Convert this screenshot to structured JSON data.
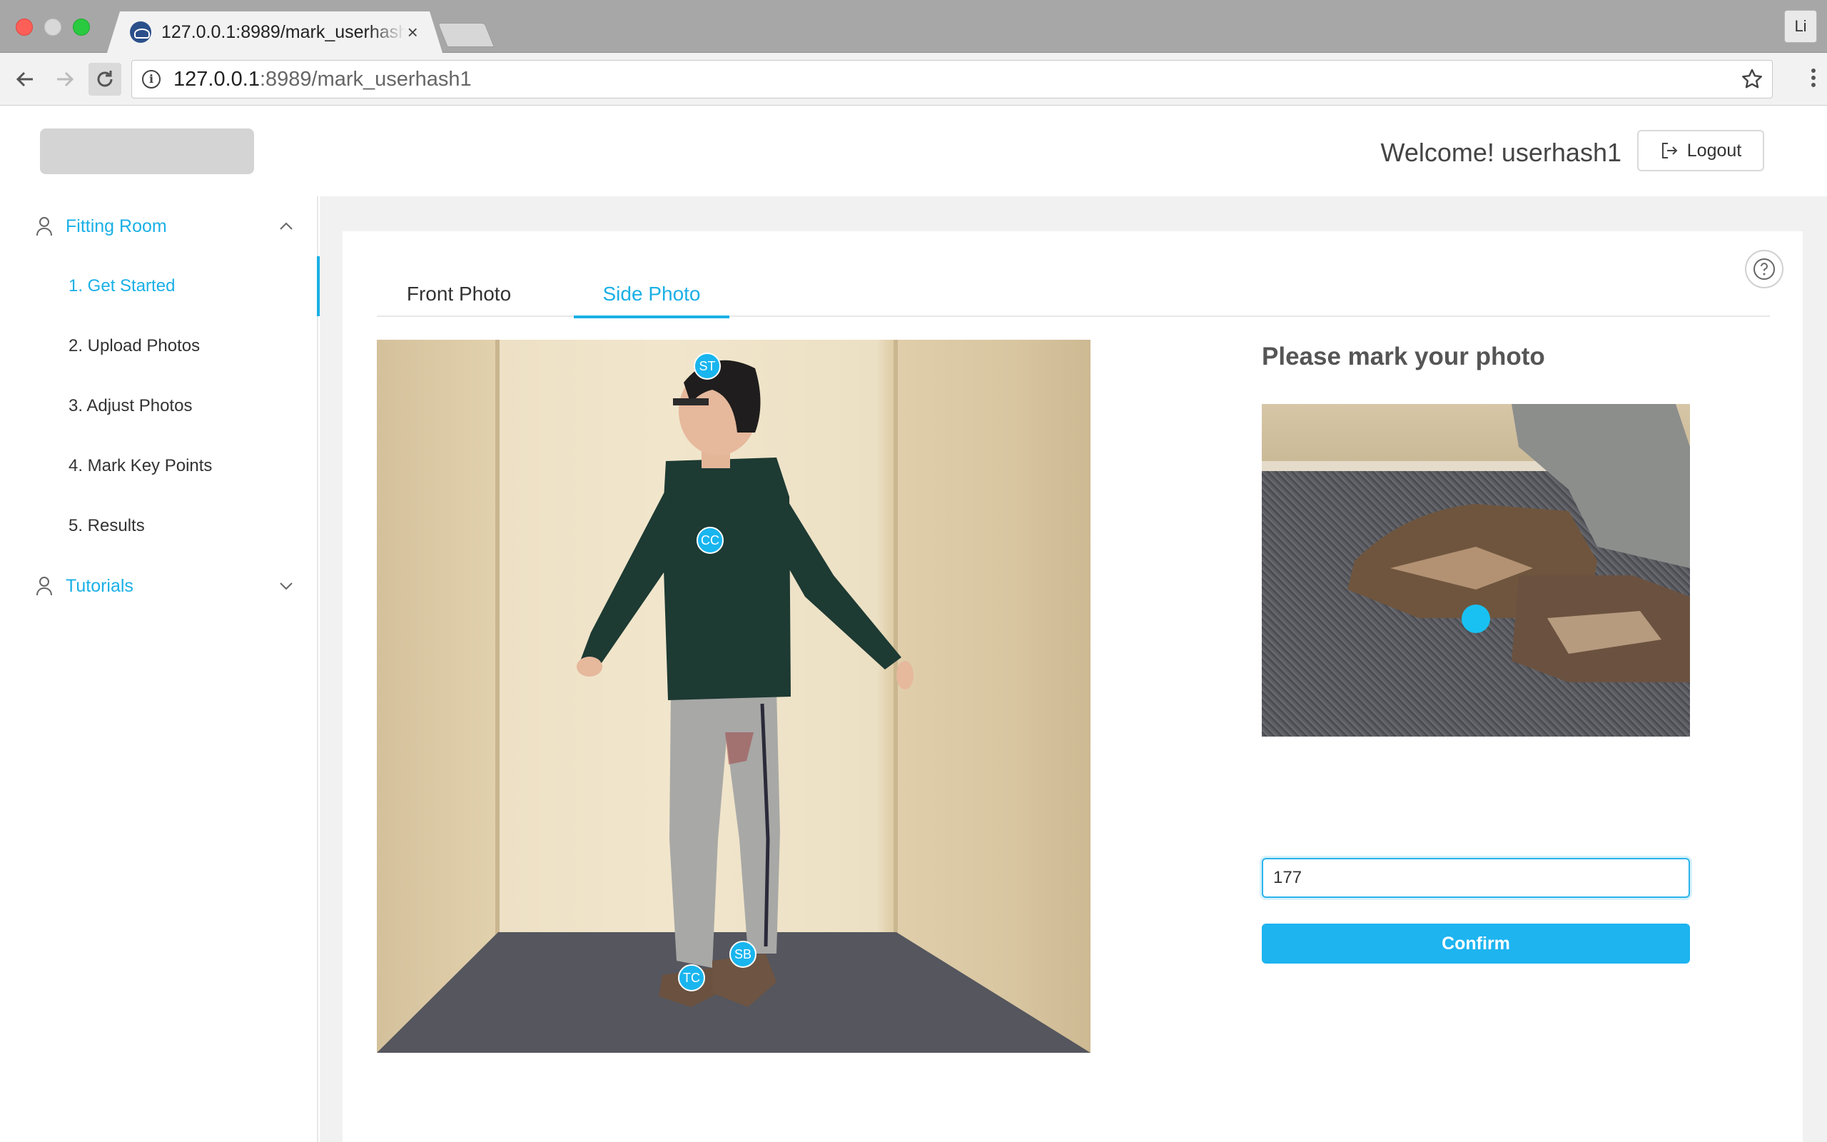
{
  "browser": {
    "tab_title": "127.0.0.1:8989/mark_userhash1",
    "tab_close": "×",
    "profile_initials": "Li",
    "url_host": "127.0.0.1",
    "url_path": ":8989/mark_userhash1"
  },
  "header": {
    "welcome": "Welcome! userhash1",
    "logout_label": "Logout"
  },
  "sidebar": {
    "fitting_room": "Fitting Room",
    "items": [
      {
        "label": "1. Get Started",
        "active": true
      },
      {
        "label": "2. Upload Photos",
        "active": false
      },
      {
        "label": "3. Adjust Photos",
        "active": false
      },
      {
        "label": "4. Mark Key Points",
        "active": false
      },
      {
        "label": "5. Results",
        "active": false
      }
    ],
    "tutorials": "Tutorials"
  },
  "tabs": {
    "front": "Front Photo",
    "side": "Side Photo",
    "selected": "Side Photo"
  },
  "photo": {
    "keypoints": [
      {
        "label": "ST"
      },
      {
        "label": "CC"
      },
      {
        "label": "SB"
      },
      {
        "label": "TC"
      }
    ]
  },
  "panel": {
    "title": "Please mark your photo",
    "height_value": "177",
    "confirm_label": "Confirm"
  },
  "colors": {
    "accent": "#1ab0e6",
    "keypoint": "#19b5ee"
  },
  "icons": [
    "back-arrow-icon",
    "forward-arrow-icon",
    "reload-icon",
    "info-icon",
    "star-icon",
    "menu-dots-icon",
    "logout-icon",
    "user-icon",
    "chevron-up-icon",
    "chevron-down-icon",
    "help-icon"
  ]
}
